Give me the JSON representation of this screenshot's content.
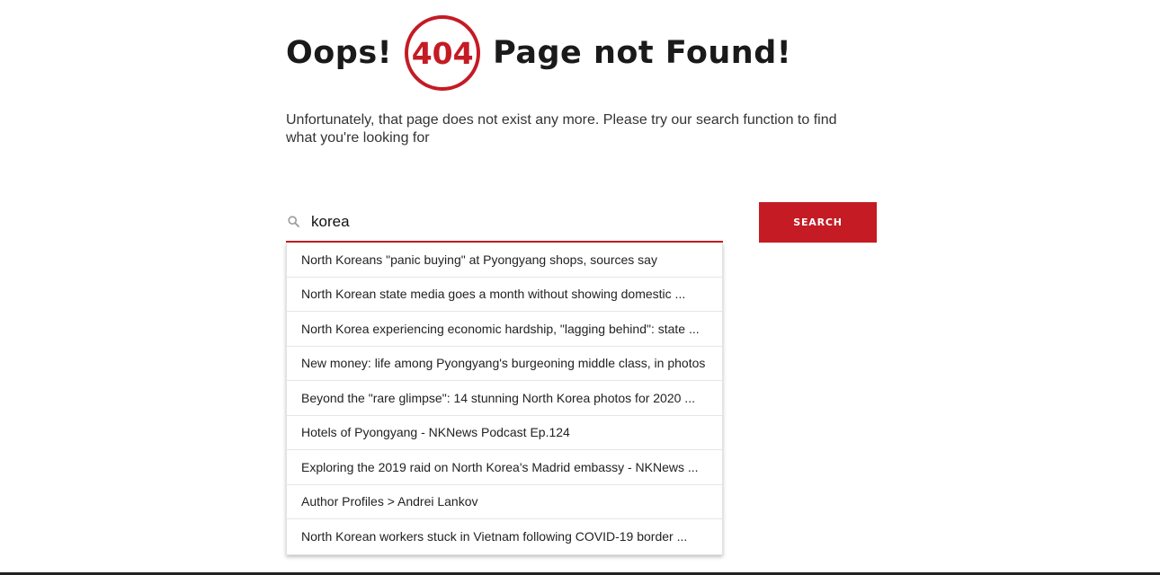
{
  "header": {
    "oops": "Oops!",
    "code": "404",
    "title": "Page not Found!"
  },
  "message": "Unfortunately, that page does not exist any more. Please try our search function to find what you're looking for",
  "search": {
    "value": "korea",
    "button_label": "SEARCH",
    "icon": "search-icon"
  },
  "suggestions": [
    "North Koreans \"panic buying\" at Pyongyang shops, sources say",
    "North Korean state media goes a month without showing domestic ...",
    "North Korea experiencing economic hardship, \"lagging behind\": state ...",
    "New money: life among Pyongyang's burgeoning middle class, in photos",
    "Beyond the \"rare glimpse\": 14 stunning North Korea photos for 2020 ...",
    "Hotels of Pyongyang - NKNews Podcast Ep.124",
    "Exploring the 2019 raid on North Korea's Madrid embassy - NKNews ...",
    "Author Profiles  >  Andrei Lankov",
    "North Korean workers stuck in Vietnam following COVID-19 border ..."
  ],
  "colors": {
    "accent": "#c41b24",
    "text": "#222222",
    "background": "#ffffff"
  }
}
